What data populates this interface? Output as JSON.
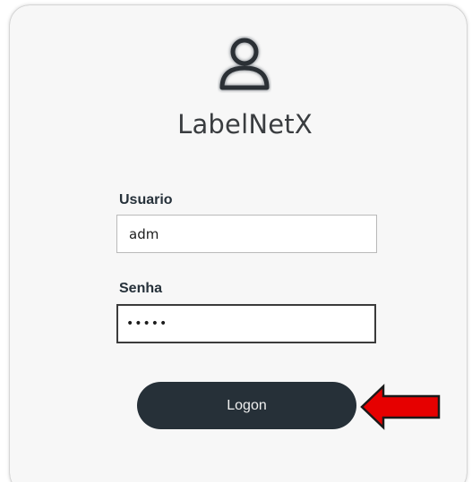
{
  "app": {
    "title": "LabelNetX"
  },
  "form": {
    "username_label": "Usuario",
    "username_value": "adm",
    "password_label": "Senha",
    "password_value": "•••••"
  },
  "actions": {
    "logon_label": "Logon"
  },
  "colors": {
    "button_bg": "#263038",
    "annotation_arrow": "#e60000"
  },
  "icons": {
    "avatar": "user-icon",
    "annotation": "arrow-left-icon"
  }
}
